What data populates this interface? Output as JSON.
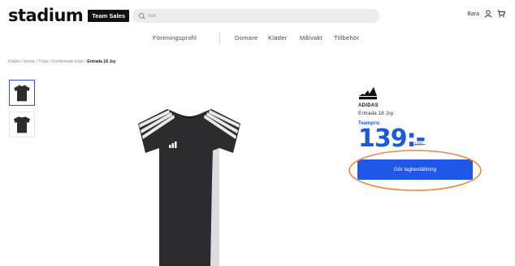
{
  "header": {
    "logo_text": "stadium",
    "logo_badge": "Team Sales",
    "search_placeholder": "Sök",
    "lang_label": "Bara"
  },
  "nav": {
    "items": [
      "Föreningsprofil",
      "Domare",
      "Kläder",
      "Målvakt",
      "Tillbehör"
    ]
  },
  "breadcrumb": {
    "items": [
      "Kläder",
      "Senior",
      "Tröjor",
      "Kortärmade tröjor"
    ],
    "separator": " / ",
    "current": "Entrada 18 Jsy"
  },
  "product": {
    "brand": "ADIDAS",
    "name": "Entrada 18 Jsy",
    "price_label": "Teampris",
    "price": "139:-",
    "old_price": "199:-",
    "cta_label": "Gör lagbeställning"
  },
  "colors": {
    "accent_blue": "#1f57e6",
    "price_blue": "#1b5bd6",
    "highlight_orange": "#ee8a3d",
    "jersey": "#2c2c2e"
  }
}
